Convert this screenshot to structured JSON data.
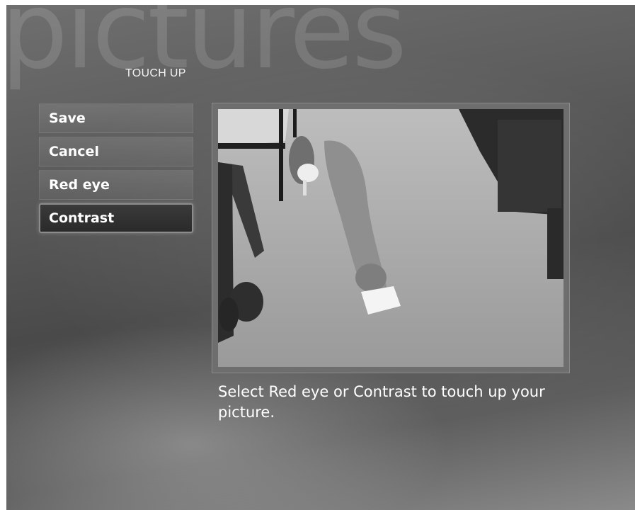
{
  "app": {
    "section_title": "pictures",
    "page_title": "TOUCH UP"
  },
  "menu": {
    "items": [
      {
        "label": "Save",
        "selected": false
      },
      {
        "label": "Cancel",
        "selected": false
      },
      {
        "label": "Red eye",
        "selected": false
      },
      {
        "label": "Contrast",
        "selected": true
      }
    ]
  },
  "preview": {
    "description_icon": "photo-preview"
  },
  "hint": {
    "text": "Select Red eye or Contrast to touch up your picture."
  }
}
